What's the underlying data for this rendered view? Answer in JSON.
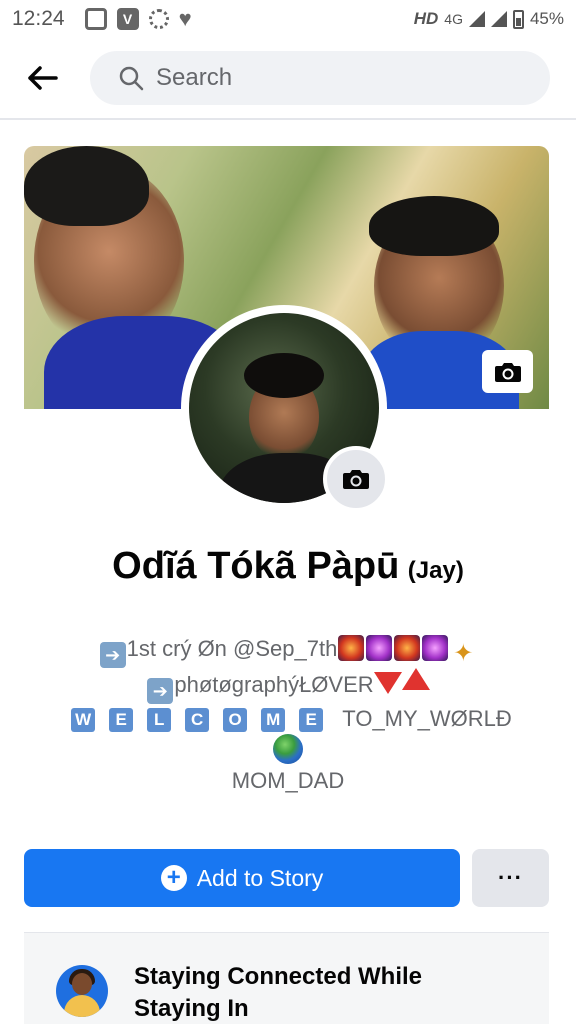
{
  "status_bar": {
    "time": "12:24",
    "network": "HD",
    "network_type": "4G",
    "battery": "45%",
    "left_icons": [
      "screen-recorder-icon",
      "vpn-v-icon",
      "sync-ring-icon",
      "heart-icon"
    ]
  },
  "header": {
    "search_placeholder": "Search"
  },
  "profile": {
    "name": "Odĩá Tókã Pàpū",
    "nickname": "(Jay)"
  },
  "bio": {
    "line1_text": "1st crý Øn @Sep_7th",
    "line2_text": "phøtøgraphýŁØVER",
    "welcome_letters": [
      "W",
      "E",
      "L",
      "C",
      "O",
      "M",
      "E"
    ],
    "line3_text": "TO_MY_WØRLĐ",
    "line5_text": "MOM_DAD"
  },
  "actions": {
    "add_story_label": "Add to Story",
    "more_label": "···"
  },
  "card": {
    "title": "Staying Connected While Staying In"
  },
  "colors": {
    "accent": "#1877f2",
    "secondary_button": "#e4e6eb"
  }
}
